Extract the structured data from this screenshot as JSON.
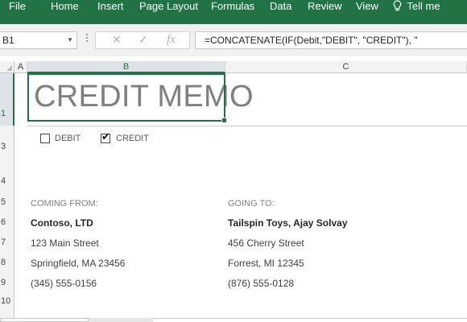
{
  "ribbon": {
    "tabs": [
      "File",
      "Home",
      "Insert",
      "Page Layout",
      "Formulas",
      "Data",
      "Review",
      "View",
      "Tell me"
    ]
  },
  "formula_bar": {
    "name_box": "B1",
    "formula": "=CONCATENATE(IF(Debit,\"DEBIT\", \"CREDIT\"), \""
  },
  "columns": [
    "A",
    "B",
    "C"
  ],
  "rows": [
    "1",
    "3",
    "4",
    "5",
    "6",
    "7",
    "8",
    "9",
    "10"
  ],
  "sheet": {
    "title": "CREDIT MEMO",
    "debit_label": "DEBIT",
    "credit_label": "CREDIT",
    "debit_checked": false,
    "credit_checked": true,
    "from": {
      "header": "COMING FROM:",
      "name": "Contoso, LTD",
      "street": "123 Main Street",
      "city": "Springfield, MA 23456",
      "phone": "(345) 555-0156"
    },
    "to": {
      "header": "GOING TO:",
      "name": "Tailspin Toys, Ajay Solvay",
      "street": "456 Cherry Street",
      "city": "Forrest, MI 12345",
      "phone": "(876) 555-0128"
    }
  },
  "colors": {
    "ribbon": "#217346",
    "selection": "#217346",
    "title": "#7f7f7f"
  }
}
